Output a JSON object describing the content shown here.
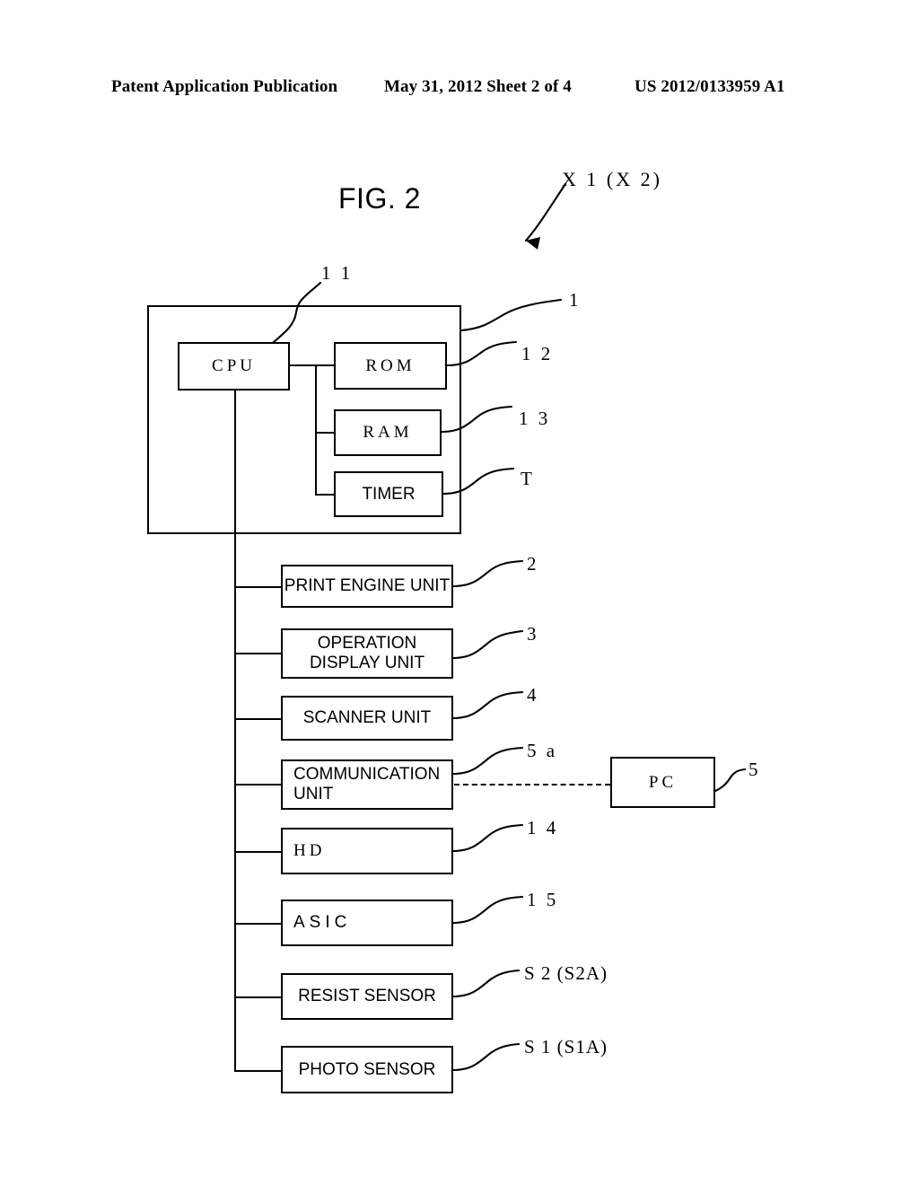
{
  "header": {
    "publication": "Patent Application Publication",
    "date_sheet": "May 31, 2012  Sheet 2 of 4",
    "patent_number": "US 2012/0133959 A1"
  },
  "figure": {
    "title": "FIG. 2",
    "system_label": "X 1  (X 2)"
  },
  "blocks": {
    "cpu": {
      "label": "CPU",
      "ref": "1 1"
    },
    "rom": {
      "label": "ROM",
      "ref": "1 2"
    },
    "ram": {
      "label": "RAM",
      "ref": "1 3"
    },
    "timer": {
      "label": "TIMER",
      "ref": "T"
    },
    "controller": {
      "ref": "1"
    },
    "print_engine": {
      "label": "PRINT ENGINE UNIT",
      "ref": "2"
    },
    "operation_display": {
      "line1": "OPERATION",
      "line2": "DISPLAY UNIT",
      "ref": "3"
    },
    "scanner": {
      "label": "SCANNER UNIT",
      "ref": "4"
    },
    "communication": {
      "line1": "COMMUNICATION",
      "line2": "UNIT",
      "ref": "5 a"
    },
    "hd": {
      "label": "HD",
      "ref": "1 4"
    },
    "asic": {
      "label": "ASIC",
      "ref": "1 5"
    },
    "resist_sensor": {
      "label": "RESIST SENSOR",
      "ref": "S 2 (S2A)"
    },
    "photo_sensor": {
      "label": "PHOTO SENSOR",
      "ref": "S 1 (S1A)"
    },
    "pc": {
      "label": "PC",
      "ref": "5"
    }
  },
  "colors": {
    "ink": "#000000",
    "paper": "#ffffff"
  }
}
